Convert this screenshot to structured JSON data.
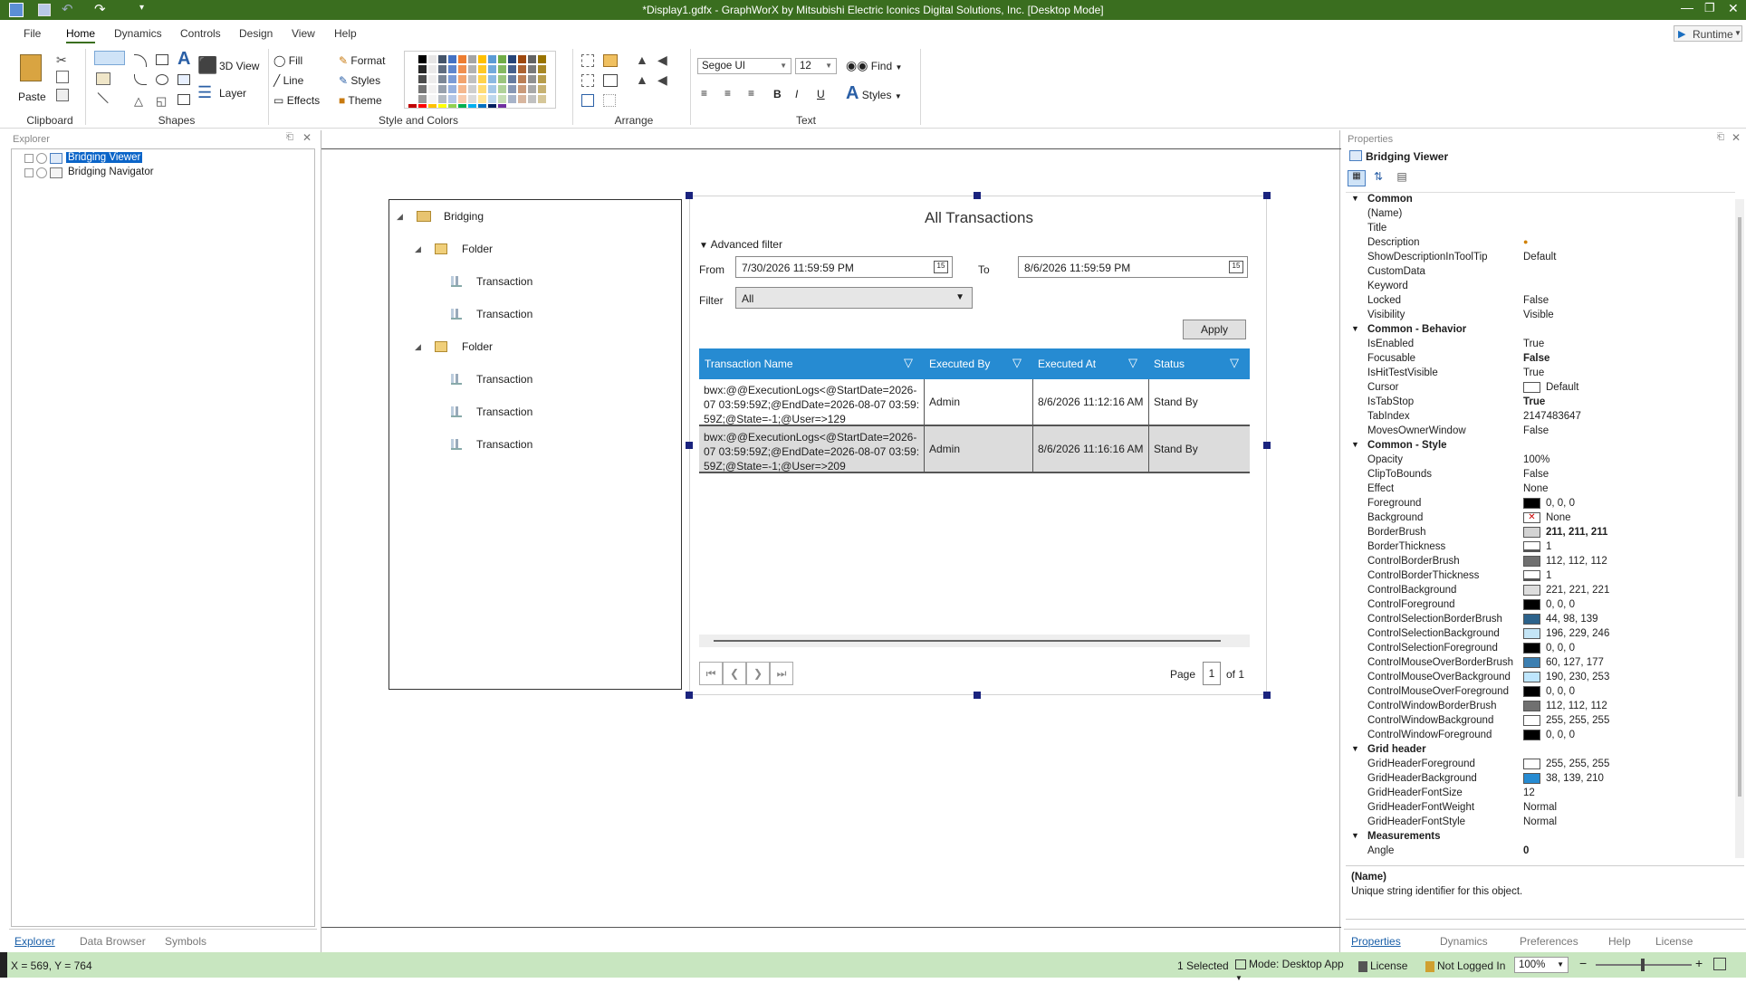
{
  "window": {
    "title": "*Display1.gdfx - GraphWorX by Mitsubishi Electric Iconics Digital Solutions, Inc. [Desktop Mode]",
    "runtime_label": "Runtime"
  },
  "menu": [
    "File",
    "Home",
    "Dynamics",
    "Controls",
    "Design",
    "View",
    "Help"
  ],
  "ribbon": {
    "clipboard": {
      "paste": "Paste",
      "group": "Clipboard"
    },
    "shapes": {
      "view3d": "3D View",
      "layer": "Layer",
      "group": "Shapes"
    },
    "style": {
      "fill": "Fill",
      "line": "Line",
      "effects": "Effects",
      "format": "Format",
      "styles": "Styles",
      "theme": "Theme",
      "group": "Style and Colors"
    },
    "arrange": {
      "group": "Arrange"
    },
    "text": {
      "font": "Segoe UI",
      "size": "12",
      "find": "Find",
      "styles": "Styles",
      "group": "Text",
      "bold": "B",
      "italic": "I",
      "underline": "U"
    }
  },
  "explorer": {
    "title": "Explorer",
    "items": [
      "Bridging Viewer",
      "Bridging Navigator"
    ],
    "tabs": [
      "Explorer",
      "Data Browser",
      "Symbols"
    ]
  },
  "navigator": {
    "root": "Bridging",
    "folders": [
      {
        "label": "Folder",
        "items": [
          "Transaction",
          "Transaction"
        ]
      },
      {
        "label": "Folder",
        "items": [
          "Transaction",
          "Transaction",
          "Transaction"
        ]
      }
    ]
  },
  "viewer": {
    "title": "All Transactions",
    "advanced_filter": "Advanced filter",
    "from_label": "From",
    "from_value": "7/30/2026 11:59:59 PM",
    "to_label": "To",
    "to_value": "8/6/2026 11:59:59 PM",
    "filter_label": "Filter",
    "filter_value": "All",
    "apply": "Apply",
    "columns": [
      "Transaction Name",
      "Executed By",
      "Executed At",
      "Status"
    ],
    "rows": [
      {
        "name": "bwx:@@ExecutionLogs<@StartDate=2026-07 03:59:59Z;@EndDate=2026-08-07 03:59:59Z;@State=-1;@User=>129",
        "by": "Admin",
        "at": "8/6/2026 11:12:16 AM",
        "status": "Stand By"
      },
      {
        "name": "bwx:@@ExecutionLogs<@StartDate=2026-07 03:59:59Z;@EndDate=2026-08-07 03:59:59Z;@State=-1;@User=>209",
        "by": "Admin",
        "at": "8/6/2026 11:16:16 AM",
        "status": "Stand By"
      }
    ],
    "page_label": "Page",
    "page_value": "1",
    "of_label": "of 1"
  },
  "properties": {
    "title": "Properties",
    "object": "Bridging Viewer",
    "sections": [
      {
        "name": "Common",
        "rows": [
          [
            "(Name)",
            "",
            ""
          ],
          [
            "Title",
            "",
            ""
          ],
          [
            "Description",
            "",
            ""
          ],
          [
            "ShowDescriptionInToolTip",
            "Default",
            ""
          ],
          [
            "CustomData",
            "",
            ""
          ],
          [
            "Keyword",
            "",
            ""
          ],
          [
            "Locked",
            "False",
            ""
          ],
          [
            "Visibility",
            "Visible",
            ""
          ]
        ]
      },
      {
        "name": "Common - Behavior",
        "rows": [
          [
            "IsEnabled",
            "True",
            ""
          ],
          [
            "Focusable",
            "False",
            "b"
          ],
          [
            "IsHitTestVisible",
            "True",
            ""
          ],
          [
            "Cursor",
            "Default",
            "#ffffff"
          ],
          [
            "IsTabStop",
            "True",
            "b"
          ],
          [
            "TabIndex",
            "2147483647",
            ""
          ],
          [
            "MovesOwnerWindow",
            "False",
            ""
          ]
        ]
      },
      {
        "name": "Common - Style",
        "rows": [
          [
            "Opacity",
            "100%",
            ""
          ],
          [
            "ClipToBounds",
            "False",
            ""
          ],
          [
            "Effect",
            "None",
            ""
          ],
          [
            "Foreground",
            "0, 0, 0",
            "#000000"
          ],
          [
            "Background",
            "None",
            "x"
          ],
          [
            "BorderBrush",
            "211, 211, 211",
            "#d3d3d3"
          ],
          [
            "BorderThickness",
            "1",
            "t"
          ],
          [
            "ControlBorderBrush",
            "112, 112, 112",
            "#707070"
          ],
          [
            "ControlBorderThickness",
            "1",
            "t"
          ],
          [
            "ControlBackground",
            "221, 221, 221",
            "#dddddd"
          ],
          [
            "ControlForeground",
            "0, 0, 0",
            "#000000"
          ],
          [
            "ControlSelectionBorderBrush",
            "44, 98, 139",
            "#2c628b"
          ],
          [
            "ControlSelectionBackground",
            "196, 229, 246",
            "#c4e5f6"
          ],
          [
            "ControlSelectionForeground",
            "0, 0, 0",
            "#000000"
          ],
          [
            "ControlMouseOverBorderBrush",
            "60, 127, 177",
            "#3c7fb1"
          ],
          [
            "ControlMouseOverBackground",
            "190, 230, 253",
            "#bee6fd"
          ],
          [
            "ControlMouseOverForeground",
            "0, 0, 0",
            "#000000"
          ],
          [
            "ControlWindowBorderBrush",
            "112, 112, 112",
            "#707070"
          ],
          [
            "ControlWindowBackground",
            "255, 255, 255",
            "#ffffff"
          ],
          [
            "ControlWindowForeground",
            "0, 0, 0",
            "#000000"
          ]
        ]
      },
      {
        "name": "Grid header",
        "rows": [
          [
            "GridHeaderForeground",
            "255, 255, 255",
            "#ffffff"
          ],
          [
            "GridHeaderBackground",
            "38, 139, 210",
            "#268bd2"
          ],
          [
            "GridHeaderFontSize",
            "12",
            ""
          ],
          [
            "GridHeaderFontWeight",
            "Normal",
            ""
          ],
          [
            "GridHeaderFontStyle",
            "Normal",
            ""
          ]
        ]
      },
      {
        "name": "Measurements",
        "rows": [
          [
            "Angle",
            "0",
            "b"
          ]
        ]
      }
    ],
    "desc_title": "(Name)",
    "desc_text": "Unique string identifier for this object.",
    "tabs": [
      "Properties",
      "Dynamics",
      "Preferences",
      "Help",
      "License"
    ]
  },
  "status": {
    "coords": "X = 569, Y = 764",
    "selected": "1 Selected",
    "mode": "Mode: Desktop App",
    "license": "License",
    "login": "Not Logged In",
    "zoom": "100%"
  },
  "colors": {
    "titlebar": "#3a6e1f",
    "accent": "#268bd2",
    "status": "#c8e6c0"
  }
}
